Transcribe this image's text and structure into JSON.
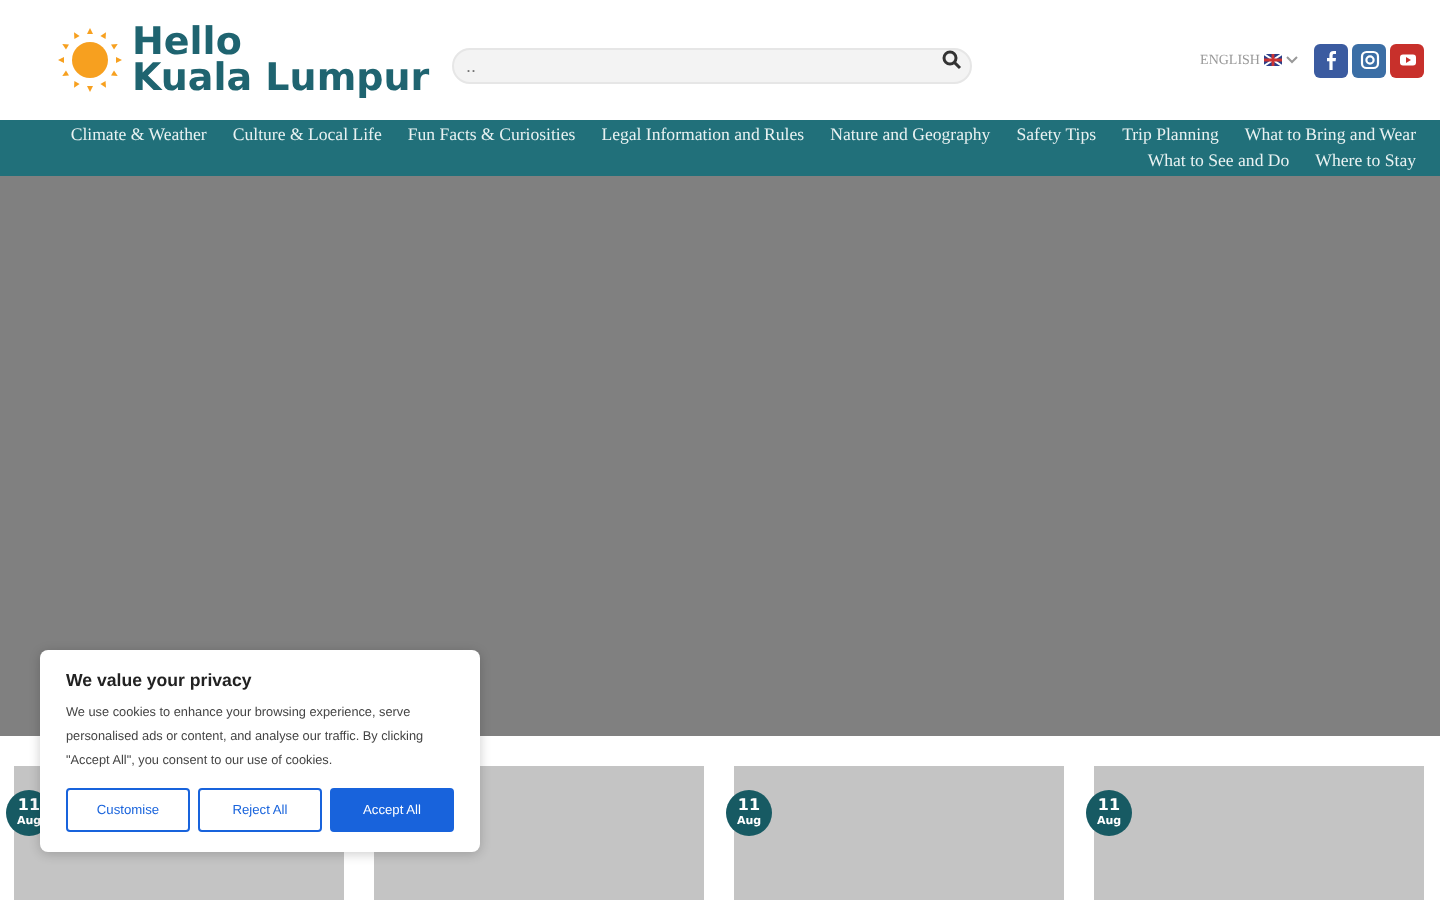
{
  "logo": {
    "line_1": "Hello",
    "line_2": "Kuala Lumpur"
  },
  "search": {
    "placeholder": ".."
  },
  "language": {
    "label": "ENGLISH"
  },
  "social": [
    {
      "kind": "facebook"
    },
    {
      "kind": "instagram"
    },
    {
      "kind": "youtube"
    }
  ],
  "nav": [
    {
      "label": "Climate & Weather"
    },
    {
      "label": "Culture & Local Life"
    },
    {
      "label": "Fun Facts & Curiosities"
    },
    {
      "label": "Legal Information and Rules"
    },
    {
      "label": "Nature and Geography"
    },
    {
      "label": "Safety Tips"
    },
    {
      "label": "Trip Planning"
    },
    {
      "label": "What to Bring and Wear"
    },
    {
      "label": "What to See and Do"
    },
    {
      "label": "Where to Stay"
    }
  ],
  "cards": [
    {
      "kind": "image",
      "day": "11",
      "month": "Aug"
    },
    {
      "kind": "image"
    },
    {
      "kind": "image",
      "day": "11",
      "month": "Aug"
    },
    {
      "kind": "image",
      "day": "11",
      "month": "Aug"
    }
  ],
  "cookie_dialog": {
    "title": "We value your privacy",
    "text": "We use cookies to enhance your browsing experience, serve personalised ads or content, and analyse our traffic. By clicking \"Accept All\", you consent to our use of cookies.",
    "buttons": [
      {
        "label": "Customise",
        "kind": "outline"
      },
      {
        "label": "Reject All",
        "kind": "outline"
      },
      {
        "label": "Accept All",
        "kind": "primary"
      }
    ]
  }
}
